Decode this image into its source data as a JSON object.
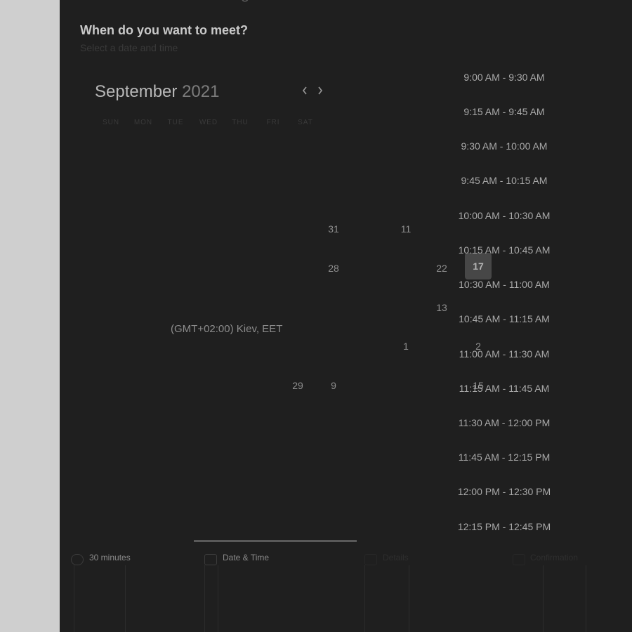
{
  "header": {
    "top_cut_title": "g",
    "heading": "When do you want to meet?",
    "subheading": "Select a date and time"
  },
  "calendar": {
    "month": "September",
    "year": "2021",
    "weekdays": [
      "SUN",
      "MON",
      "TUE",
      "WED",
      "THU",
      "FRI",
      "SAT"
    ],
    "visible_days": [
      {
        "label": "31"
      },
      {
        "label": "11"
      },
      {
        "label": "28"
      },
      {
        "label": "22"
      },
      {
        "label": "17"
      },
      {
        "label": "13"
      },
      {
        "label": "1"
      },
      {
        "label": "2"
      },
      {
        "label": "29"
      },
      {
        "label": "9"
      },
      {
        "label": "15"
      }
    ],
    "selected_day": "17"
  },
  "timezone": "(GMT+02:00) Kiev, EET",
  "time_slots": [
    "9:00 AM - 9:30 AM",
    "9:15 AM - 9:45 AM",
    "9:30 AM - 10:00 AM",
    "9:45 AM - 10:15 AM",
    "10:00 AM - 10:30 AM",
    "10:15 AM - 10:45 AM",
    "10:30 AM - 11:00 AM",
    "10:45 AM - 11:15 AM",
    "11:00 AM - 11:30 AM",
    "11:15 AM - 11:45 AM",
    "11:30 AM - 12:00 PM",
    "11:45 AM - 12:15 PM",
    "12:00 PM - 12:30 PM",
    "12:15 PM - 12:45 PM"
  ],
  "steps": [
    {
      "label": "30 minutes",
      "icon": "clock-icon"
    },
    {
      "label": "Date & Time",
      "icon": "calendar-icon"
    },
    {
      "label": "Details",
      "icon": "user-icon"
    },
    {
      "label": "Confirmation",
      "icon": "check-icon"
    }
  ]
}
